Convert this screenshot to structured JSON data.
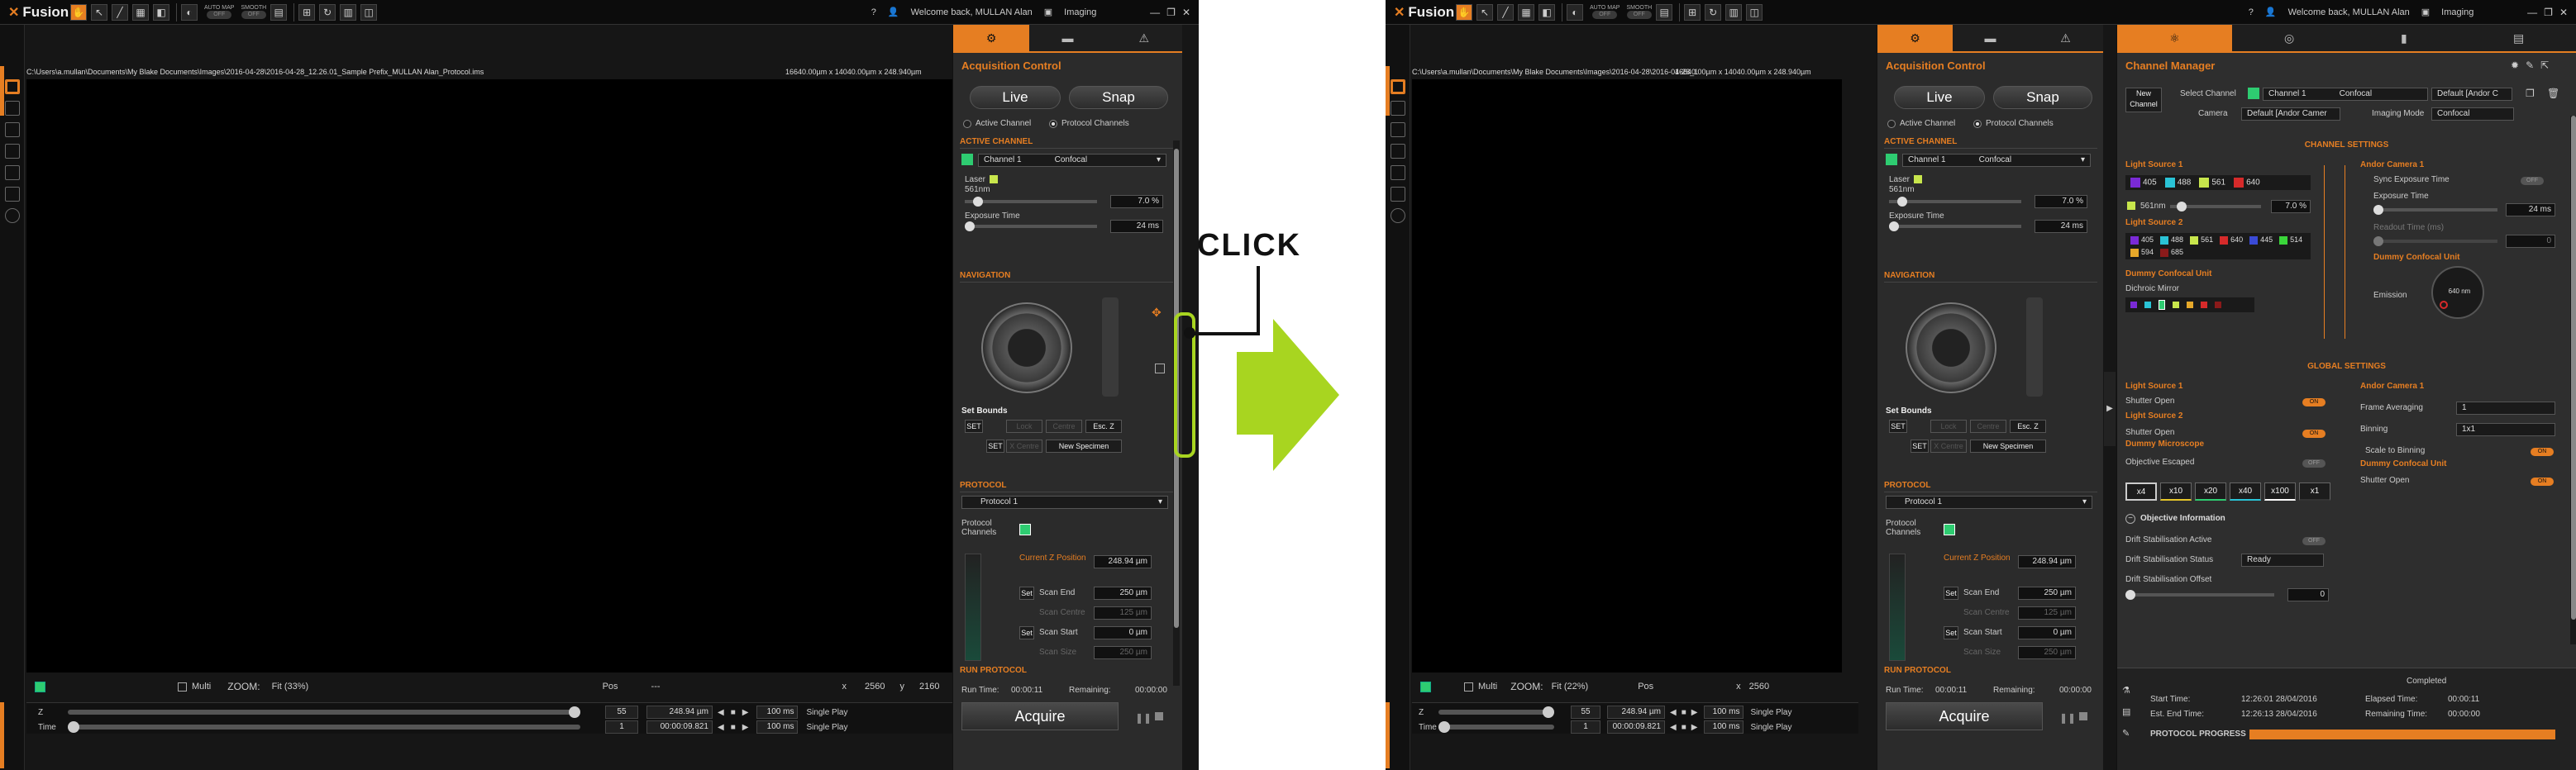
{
  "app_title": "Fusion",
  "welcome": "Welcome back, MULLAN Alan",
  "module": "Imaging",
  "toolbar": {
    "automap": "AUTO MAP",
    "smooth": "SMOOTH",
    "off": "OFF"
  },
  "left_file_path": "C:\\Users\\a.mullan\\Documents\\My Blake Documents\\Images\\2016-04-28\\2016-04-28_12.26.01_Sample Prefix_MULLAN Alan_Protocol.ims",
  "right_file_path": "C:\\Users\\a.mullan\\Documents\\My Blake Documents\\Images\\2016-04-28\\2016-04-28_1",
  "image_dims": "16640.00µm x 14040.00µm x 248.940µm",
  "status": {
    "multi": "Multi",
    "zoom_label": "ZOOM:",
    "zoom_left": "Fit (33%)",
    "zoom_right": "Fit (22%)",
    "pos_label": "Pos",
    "pos_val": "---",
    "x_label": "x",
    "x_val": "2560",
    "y_label": "y",
    "y_val": "2160"
  },
  "track": {
    "z_label": "Z",
    "time_label": "Time",
    "z_num": "55",
    "z_val": "248.94 µm",
    "z_ms": "100 ms",
    "t_num": "1",
    "t_val": "00:00:09.821",
    "t_ms": "100 ms",
    "play": "Single Play"
  },
  "acq": {
    "title": "Acquisition Control",
    "live": "Live",
    "snap": "Snap",
    "active_channel": "Active Channel",
    "protocol_channels": "Protocol Channels",
    "active_channel_header": "ACTIVE CHANNEL",
    "channel_name": "Channel 1",
    "channel_mode": "Confocal",
    "laser": "Laser",
    "laser_nm": "561nm",
    "laser_pct": "7.0 %",
    "exposure": "Exposure Time",
    "exposure_val": "24 ms",
    "navigation": "NAVIGATION",
    "set_bounds": "Set Bounds",
    "set": "SET",
    "lock": "Lock",
    "centre": "Centre",
    "esc_z": "Esc. Z",
    "x_centre": "X Centre",
    "new_specimen": "New Specimen",
    "protocol_header": "PROTOCOL",
    "protocol_name": "Protocol 1",
    "protocol_channels_lbl": "Protocol Channels",
    "current_z": "Current Z Position",
    "current_z_val": "248.94 µm",
    "scan_end": "Scan End",
    "scan_end_val": "250 µm",
    "scan_centre": "Scan Centre",
    "scan_centre_val": "125 µm",
    "scan_start": "Scan Start",
    "scan_start_val": "0 µm",
    "scan_size": "Scan Size",
    "scan_size_val": "250 µm",
    "run_protocol": "RUN PROTOCOL",
    "run_time": "Run Time:",
    "run_time_val": "00:00:11",
    "remaining": "Remaining:",
    "remaining_val": "00:00:00",
    "acquire": "Acquire"
  },
  "annot": {
    "click": "CLICK"
  },
  "cm": {
    "title": "Channel Manager",
    "new_channel": "New Channel",
    "select_channel": "Select Channel",
    "channel_name": "Channel 1",
    "channel_mode": "Confocal",
    "default_andor": "Default [Andor C",
    "camera": "Camera",
    "camera_val": "Default [Andor Camer",
    "imaging_mode": "Imaging Mode",
    "imaging_mode_val": "Confocal",
    "channel_settings": "CHANNEL SETTINGS",
    "light_source_1": "Light Source 1",
    "ls1_lines": [
      "405",
      "488",
      "561",
      "640"
    ],
    "slider": "561nm",
    "slider_val": "7.0 %",
    "light_source_2": "Light Source 2",
    "ls2_lines": [
      "405",
      "488",
      "561",
      "640",
      "445",
      "514",
      "594",
      "685"
    ],
    "dummy_confocal": "Dummy Confocal Unit",
    "dichroic": "Dichroic Mirror",
    "andor_camera": "Andor Camera 1",
    "sync_exposure": "Sync Exposure Time",
    "exposure": "Exposure Time",
    "exposure_val": "24 ms",
    "readout": "Readout Time (ms)",
    "readout_val": "0",
    "dummy_confocal2": "Dummy Confocal Unit",
    "emission": "Emission",
    "emission_val": "640 nm",
    "global_settings": "GLOBAL SETTINGS",
    "gs_ls1": "Light Source 1",
    "shutter_open": "Shutter Open",
    "gs_ls2": "Light Source 2",
    "shutter_open2": "Shutter Open",
    "dummy_microscope": "Dummy Microscope",
    "objective_escaped": "Objective Escaped",
    "lenses": [
      "x4",
      "x10",
      "x20",
      "x40",
      "x100",
      "x1"
    ],
    "objective_info": "Objective Information",
    "drift_active": "Drift Stabilisation Active",
    "drift_status": "Drift Stabilisation Status",
    "drift_status_val": "Ready",
    "drift_offset": "Drift Stabilisation Offset",
    "drift_offset_val": "0",
    "gs_camera": "Andor Camera 1",
    "frame_avg": "Frame Averaging",
    "frame_avg_val": "1",
    "binning": "Binning",
    "binning_val": "1x1",
    "scale_binning": "Scale to Binning",
    "gs_confocal": "Dummy Confocal Unit",
    "shutter_open3": "Shutter Open",
    "on": "ON",
    "off": "OFF",
    "completed": "Completed",
    "start_time": "Start Time:",
    "start_time_val": "12:26:01 28/04/2016",
    "elapsed": "Elapsed Time:",
    "elapsed_val": "00:00:11",
    "est_end": "Est. End Time:",
    "est_end_val": "12:26:13 28/04/2016",
    "remaining": "Remaining Time:",
    "remaining_val": "00:00:00",
    "protocol_progress": "PROTOCOL PROGRESS",
    "progress": 1.0
  }
}
